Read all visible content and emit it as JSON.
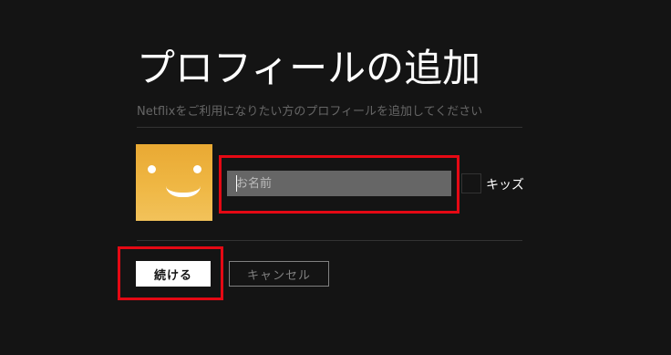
{
  "page": {
    "title": "プロフィールの追加",
    "subtitle": "Netflixをご利用になりたい方のプロフィールを追加してください"
  },
  "profile": {
    "avatar_icon": "smiley-face-icon",
    "avatar_color": "#efb744",
    "name_input": {
      "placeholder": "お名前",
      "value": ""
    },
    "kids_label": "キッズ",
    "kids_checked": false
  },
  "actions": {
    "continue_label": "続ける",
    "cancel_label": "キャンセル"
  },
  "colors": {
    "background": "#141414",
    "highlight": "#e50914",
    "input_bg": "#666666"
  }
}
